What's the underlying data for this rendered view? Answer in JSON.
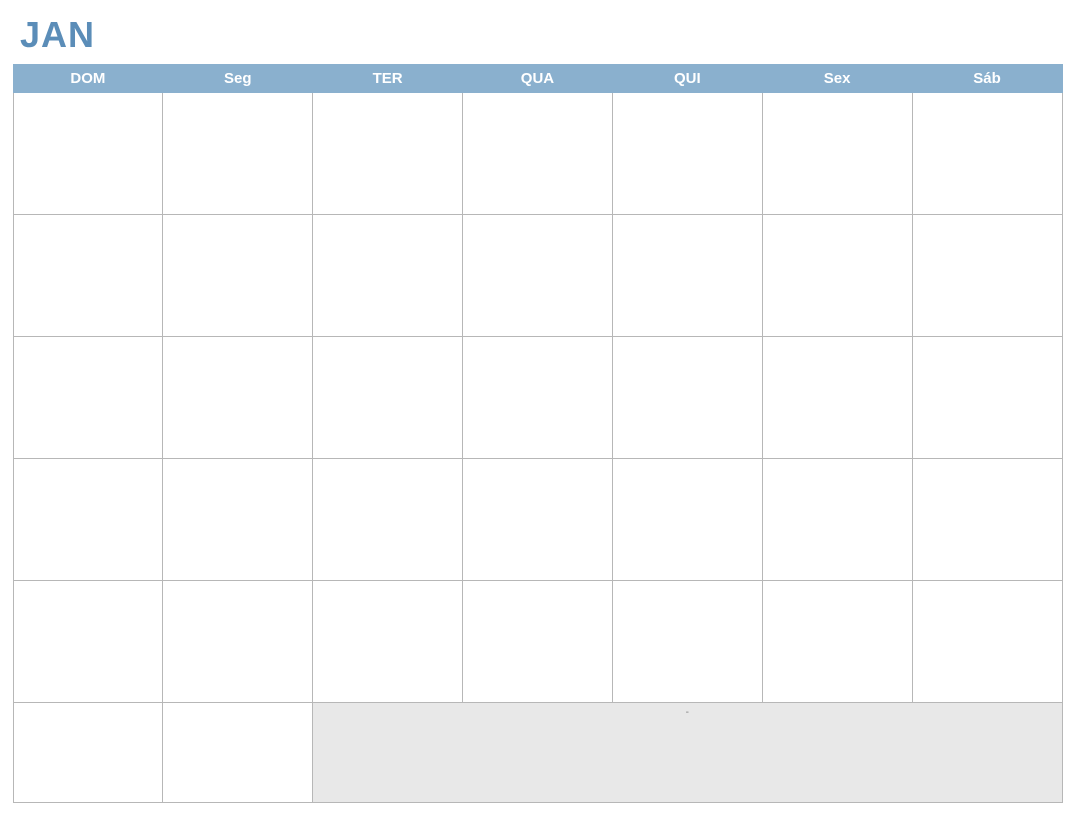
{
  "month_title": "JAN",
  "weekdays": [
    "DOM",
    "Seg",
    "TER",
    "QUA",
    "QUI",
    "Sex",
    "Sáb"
  ],
  "notes_label": "-"
}
